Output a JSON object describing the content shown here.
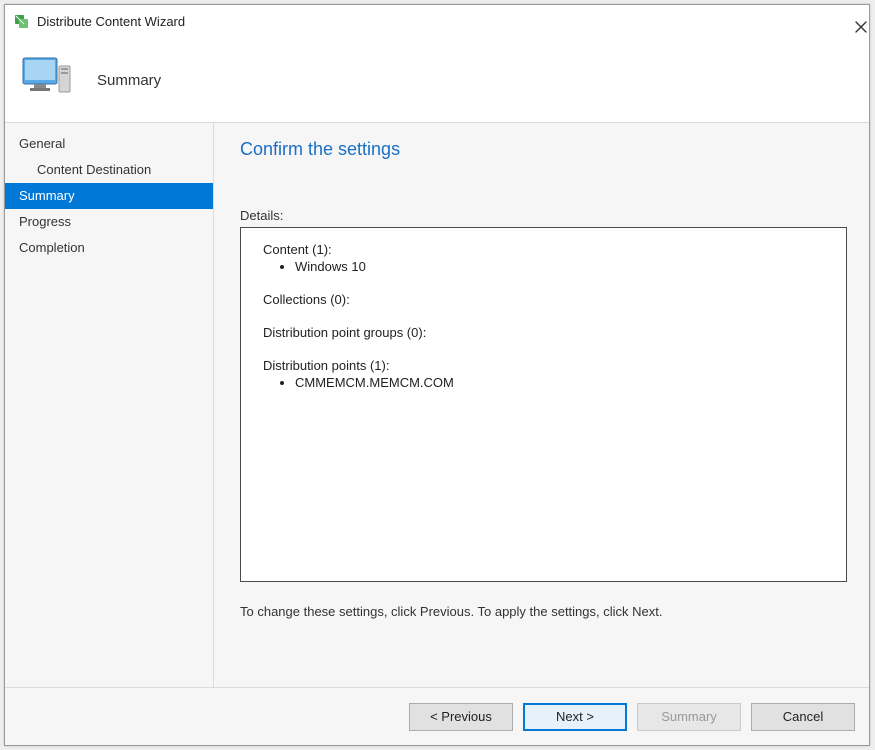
{
  "window": {
    "title": "Distribute Content Wizard"
  },
  "header": {
    "page_title": "Summary"
  },
  "sidebar": {
    "items": [
      {
        "label": "General",
        "indent": false,
        "active": false
      },
      {
        "label": "Content Destination",
        "indent": true,
        "active": false
      },
      {
        "label": "Summary",
        "indent": false,
        "active": true
      },
      {
        "label": "Progress",
        "indent": false,
        "active": false
      },
      {
        "label": "Completion",
        "indent": false,
        "active": false
      }
    ]
  },
  "main": {
    "heading": "Confirm the settings",
    "details_label": "Details:",
    "sections": [
      {
        "title": "Content (1):",
        "items": [
          "Windows 10"
        ]
      },
      {
        "title": "Collections (0):",
        "items": []
      },
      {
        "title": "Distribution point groups (0):",
        "items": []
      },
      {
        "title": "Distribution points (1):",
        "items": [
          "CMMEMCM.MEMCM.COM"
        ]
      }
    ],
    "hint": "To change these settings, click Previous. To apply the settings, click Next."
  },
  "footer": {
    "previous": "< Previous",
    "next": "Next >",
    "summary": "Summary",
    "cancel": "Cancel"
  }
}
